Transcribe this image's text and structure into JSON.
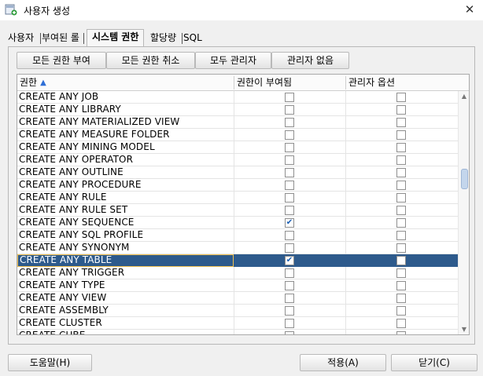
{
  "window": {
    "title": "사용자 생성",
    "close_glyph": "✕"
  },
  "tabs": [
    {
      "label": "사용자"
    },
    {
      "label": "부여된 롤"
    },
    {
      "label": "시스템 권한"
    },
    {
      "label": "할당량"
    },
    {
      "label": "SQL"
    }
  ],
  "active_tab": "시스템 권한",
  "toolbar": {
    "grant_all": "모든 권한 부여",
    "revoke_all": "모든 권한 취소",
    "all_admin": "모두 관리자",
    "no_admin": "관리자 없음"
  },
  "grid": {
    "columns": {
      "privilege": "권한",
      "granted": "권한이 부여됨",
      "admin": "관리자 옵션"
    },
    "sort_icon": "sort-ascending-icon",
    "rows": [
      {
        "name": "CREATE ANY JOB",
        "granted": false,
        "admin": false
      },
      {
        "name": "CREATE ANY LIBRARY",
        "granted": false,
        "admin": false
      },
      {
        "name": "CREATE ANY MATERIALIZED VIEW",
        "granted": false,
        "admin": false
      },
      {
        "name": "CREATE ANY MEASURE FOLDER",
        "granted": false,
        "admin": false
      },
      {
        "name": "CREATE ANY MINING MODEL",
        "granted": false,
        "admin": false
      },
      {
        "name": "CREATE ANY OPERATOR",
        "granted": false,
        "admin": false
      },
      {
        "name": "CREATE ANY OUTLINE",
        "granted": false,
        "admin": false
      },
      {
        "name": "CREATE ANY PROCEDURE",
        "granted": false,
        "admin": false
      },
      {
        "name": "CREATE ANY RULE",
        "granted": false,
        "admin": false
      },
      {
        "name": "CREATE ANY RULE SET",
        "granted": false,
        "admin": false
      },
      {
        "name": "CREATE ANY SEQUENCE",
        "granted": true,
        "admin": false
      },
      {
        "name": "CREATE ANY SQL PROFILE",
        "granted": false,
        "admin": false
      },
      {
        "name": "CREATE ANY SYNONYM",
        "granted": false,
        "admin": false
      },
      {
        "name": "CREATE ANY TABLE",
        "granted": true,
        "admin": false,
        "selected": true
      },
      {
        "name": "CREATE ANY TRIGGER",
        "granted": false,
        "admin": false
      },
      {
        "name": "CREATE ANY TYPE",
        "granted": false,
        "admin": false
      },
      {
        "name": "CREATE ANY VIEW",
        "granted": false,
        "admin": false
      },
      {
        "name": "CREATE ASSEMBLY",
        "granted": false,
        "admin": false
      },
      {
        "name": "CREATE CLUSTER",
        "granted": false,
        "admin": false
      },
      {
        "name": "CREATE CUBE",
        "granted": false,
        "admin": false
      }
    ],
    "scroll_position": 0.33
  },
  "footer": {
    "help": "도움말(H)",
    "apply": "적용(A)",
    "close": "닫기(C)"
  },
  "colors": {
    "selection": "#2d5a8c",
    "accent": "#2f6fd6",
    "check": "#1a5fb4"
  }
}
